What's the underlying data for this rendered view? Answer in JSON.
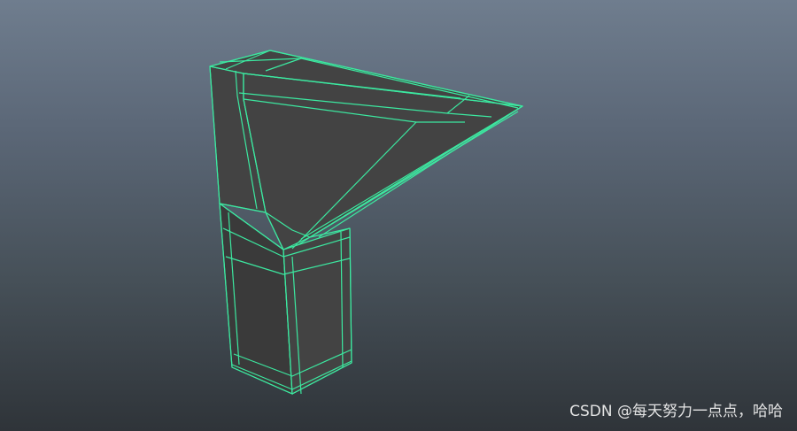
{
  "viewport": {
    "hud_label": "",
    "background_top": "#6f7d8e",
    "background_bottom": "#2f3439"
  },
  "model": {
    "face_color": "#434343",
    "face_shadow": "#3a3a3a",
    "wire_color": "#3ce8a0"
  },
  "watermark": {
    "text": "CSDN @每天努力一点点，哈哈"
  }
}
